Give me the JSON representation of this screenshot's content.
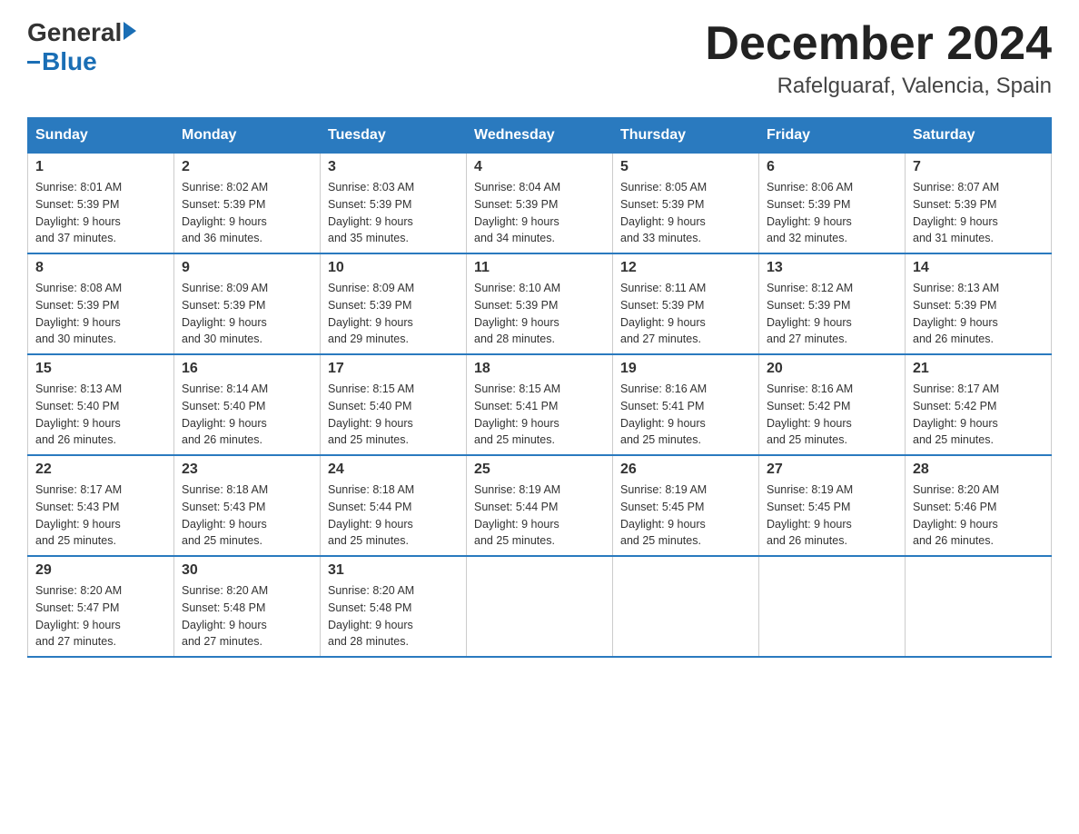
{
  "header": {
    "logo_general": "General",
    "logo_blue": "Blue",
    "month_title": "December 2024",
    "location": "Rafelguaraf, Valencia, Spain"
  },
  "weekdays": [
    "Sunday",
    "Monday",
    "Tuesday",
    "Wednesday",
    "Thursday",
    "Friday",
    "Saturday"
  ],
  "weeks": [
    [
      {
        "day": "1",
        "sunrise": "8:01 AM",
        "sunset": "5:39 PM",
        "daylight": "9 hours and 37 minutes."
      },
      {
        "day": "2",
        "sunrise": "8:02 AM",
        "sunset": "5:39 PM",
        "daylight": "9 hours and 36 minutes."
      },
      {
        "day": "3",
        "sunrise": "8:03 AM",
        "sunset": "5:39 PM",
        "daylight": "9 hours and 35 minutes."
      },
      {
        "day": "4",
        "sunrise": "8:04 AM",
        "sunset": "5:39 PM",
        "daylight": "9 hours and 34 minutes."
      },
      {
        "day": "5",
        "sunrise": "8:05 AM",
        "sunset": "5:39 PM",
        "daylight": "9 hours and 33 minutes."
      },
      {
        "day": "6",
        "sunrise": "8:06 AM",
        "sunset": "5:39 PM",
        "daylight": "9 hours and 32 minutes."
      },
      {
        "day": "7",
        "sunrise": "8:07 AM",
        "sunset": "5:39 PM",
        "daylight": "9 hours and 31 minutes."
      }
    ],
    [
      {
        "day": "8",
        "sunrise": "8:08 AM",
        "sunset": "5:39 PM",
        "daylight": "9 hours and 30 minutes."
      },
      {
        "day": "9",
        "sunrise": "8:09 AM",
        "sunset": "5:39 PM",
        "daylight": "9 hours and 30 minutes."
      },
      {
        "day": "10",
        "sunrise": "8:09 AM",
        "sunset": "5:39 PM",
        "daylight": "9 hours and 29 minutes."
      },
      {
        "day": "11",
        "sunrise": "8:10 AM",
        "sunset": "5:39 PM",
        "daylight": "9 hours and 28 minutes."
      },
      {
        "day": "12",
        "sunrise": "8:11 AM",
        "sunset": "5:39 PM",
        "daylight": "9 hours and 27 minutes."
      },
      {
        "day": "13",
        "sunrise": "8:12 AM",
        "sunset": "5:39 PM",
        "daylight": "9 hours and 27 minutes."
      },
      {
        "day": "14",
        "sunrise": "8:13 AM",
        "sunset": "5:39 PM",
        "daylight": "9 hours and 26 minutes."
      }
    ],
    [
      {
        "day": "15",
        "sunrise": "8:13 AM",
        "sunset": "5:40 PM",
        "daylight": "9 hours and 26 minutes."
      },
      {
        "day": "16",
        "sunrise": "8:14 AM",
        "sunset": "5:40 PM",
        "daylight": "9 hours and 26 minutes."
      },
      {
        "day": "17",
        "sunrise": "8:15 AM",
        "sunset": "5:40 PM",
        "daylight": "9 hours and 25 minutes."
      },
      {
        "day": "18",
        "sunrise": "8:15 AM",
        "sunset": "5:41 PM",
        "daylight": "9 hours and 25 minutes."
      },
      {
        "day": "19",
        "sunrise": "8:16 AM",
        "sunset": "5:41 PM",
        "daylight": "9 hours and 25 minutes."
      },
      {
        "day": "20",
        "sunrise": "8:16 AM",
        "sunset": "5:42 PM",
        "daylight": "9 hours and 25 minutes."
      },
      {
        "day": "21",
        "sunrise": "8:17 AM",
        "sunset": "5:42 PM",
        "daylight": "9 hours and 25 minutes."
      }
    ],
    [
      {
        "day": "22",
        "sunrise": "8:17 AM",
        "sunset": "5:43 PM",
        "daylight": "9 hours and 25 minutes."
      },
      {
        "day": "23",
        "sunrise": "8:18 AM",
        "sunset": "5:43 PM",
        "daylight": "9 hours and 25 minutes."
      },
      {
        "day": "24",
        "sunrise": "8:18 AM",
        "sunset": "5:44 PM",
        "daylight": "9 hours and 25 minutes."
      },
      {
        "day": "25",
        "sunrise": "8:19 AM",
        "sunset": "5:44 PM",
        "daylight": "9 hours and 25 minutes."
      },
      {
        "day": "26",
        "sunrise": "8:19 AM",
        "sunset": "5:45 PM",
        "daylight": "9 hours and 25 minutes."
      },
      {
        "day": "27",
        "sunrise": "8:19 AM",
        "sunset": "5:45 PM",
        "daylight": "9 hours and 26 minutes."
      },
      {
        "day": "28",
        "sunrise": "8:20 AM",
        "sunset": "5:46 PM",
        "daylight": "9 hours and 26 minutes."
      }
    ],
    [
      {
        "day": "29",
        "sunrise": "8:20 AM",
        "sunset": "5:47 PM",
        "daylight": "9 hours and 27 minutes."
      },
      {
        "day": "30",
        "sunrise": "8:20 AM",
        "sunset": "5:48 PM",
        "daylight": "9 hours and 27 minutes."
      },
      {
        "day": "31",
        "sunrise": "8:20 AM",
        "sunset": "5:48 PM",
        "daylight": "9 hours and 28 minutes."
      },
      null,
      null,
      null,
      null
    ]
  ]
}
